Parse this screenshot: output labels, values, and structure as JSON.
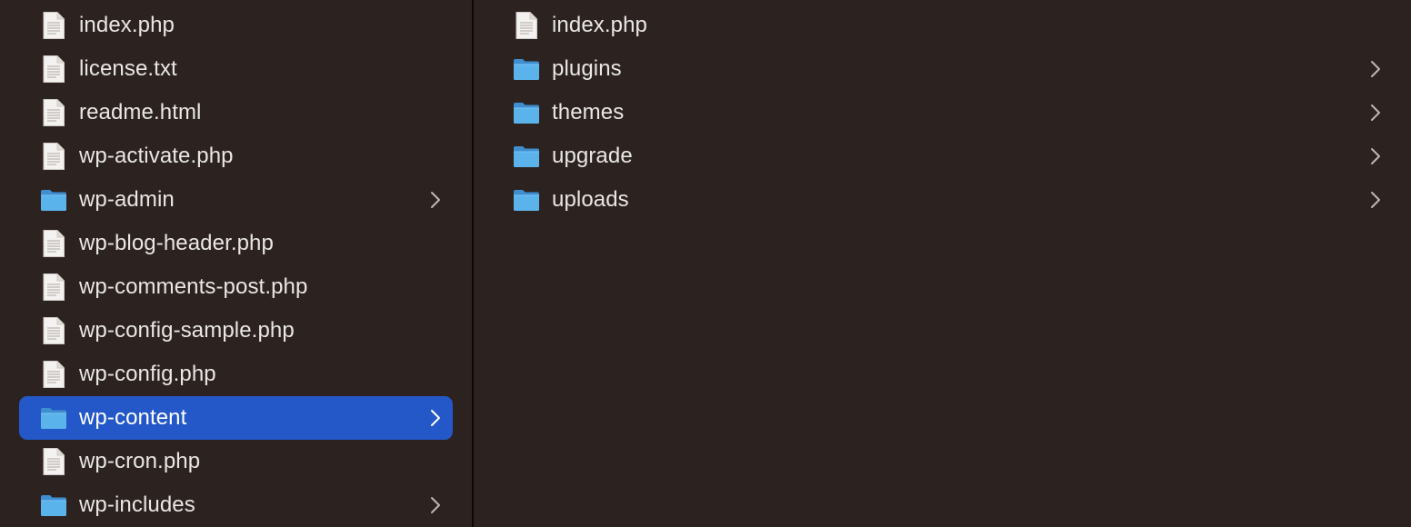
{
  "colors": {
    "background": "#2c2321",
    "selection": "#2458c8",
    "folder": "#5bb3ec",
    "text": "#e9e6e4"
  },
  "left_column": {
    "items": [
      {
        "label": "index.php",
        "type": "file",
        "icon": "document-icon",
        "has_children": false,
        "selected": false
      },
      {
        "label": "license.txt",
        "type": "file",
        "icon": "document-icon",
        "has_children": false,
        "selected": false
      },
      {
        "label": "readme.html",
        "type": "file",
        "icon": "document-icon",
        "has_children": false,
        "selected": false
      },
      {
        "label": "wp-activate.php",
        "type": "file",
        "icon": "document-icon",
        "has_children": false,
        "selected": false
      },
      {
        "label": "wp-admin",
        "type": "folder",
        "icon": "folder-icon",
        "has_children": true,
        "selected": false
      },
      {
        "label": "wp-blog-header.php",
        "type": "file",
        "icon": "document-icon",
        "has_children": false,
        "selected": false
      },
      {
        "label": "wp-comments-post.php",
        "type": "file",
        "icon": "document-icon",
        "has_children": false,
        "selected": false
      },
      {
        "label": "wp-config-sample.php",
        "type": "file",
        "icon": "document-icon",
        "has_children": false,
        "selected": false
      },
      {
        "label": "wp-config.php",
        "type": "file",
        "icon": "document-icon",
        "has_children": false,
        "selected": false
      },
      {
        "label": "wp-content",
        "type": "folder",
        "icon": "folder-icon",
        "has_children": true,
        "selected": true
      },
      {
        "label": "wp-cron.php",
        "type": "file",
        "icon": "document-icon",
        "has_children": false,
        "selected": false
      },
      {
        "label": "wp-includes",
        "type": "folder",
        "icon": "folder-icon",
        "has_children": true,
        "selected": false
      }
    ]
  },
  "right_column": {
    "items": [
      {
        "label": "index.php",
        "type": "file",
        "icon": "document-icon",
        "has_children": false
      },
      {
        "label": "plugins",
        "type": "folder",
        "icon": "folder-icon",
        "has_children": true
      },
      {
        "label": "themes",
        "type": "folder",
        "icon": "folder-icon",
        "has_children": true
      },
      {
        "label": "upgrade",
        "type": "folder",
        "icon": "folder-icon",
        "has_children": true
      },
      {
        "label": "uploads",
        "type": "folder",
        "icon": "folder-icon",
        "has_children": true
      }
    ]
  }
}
